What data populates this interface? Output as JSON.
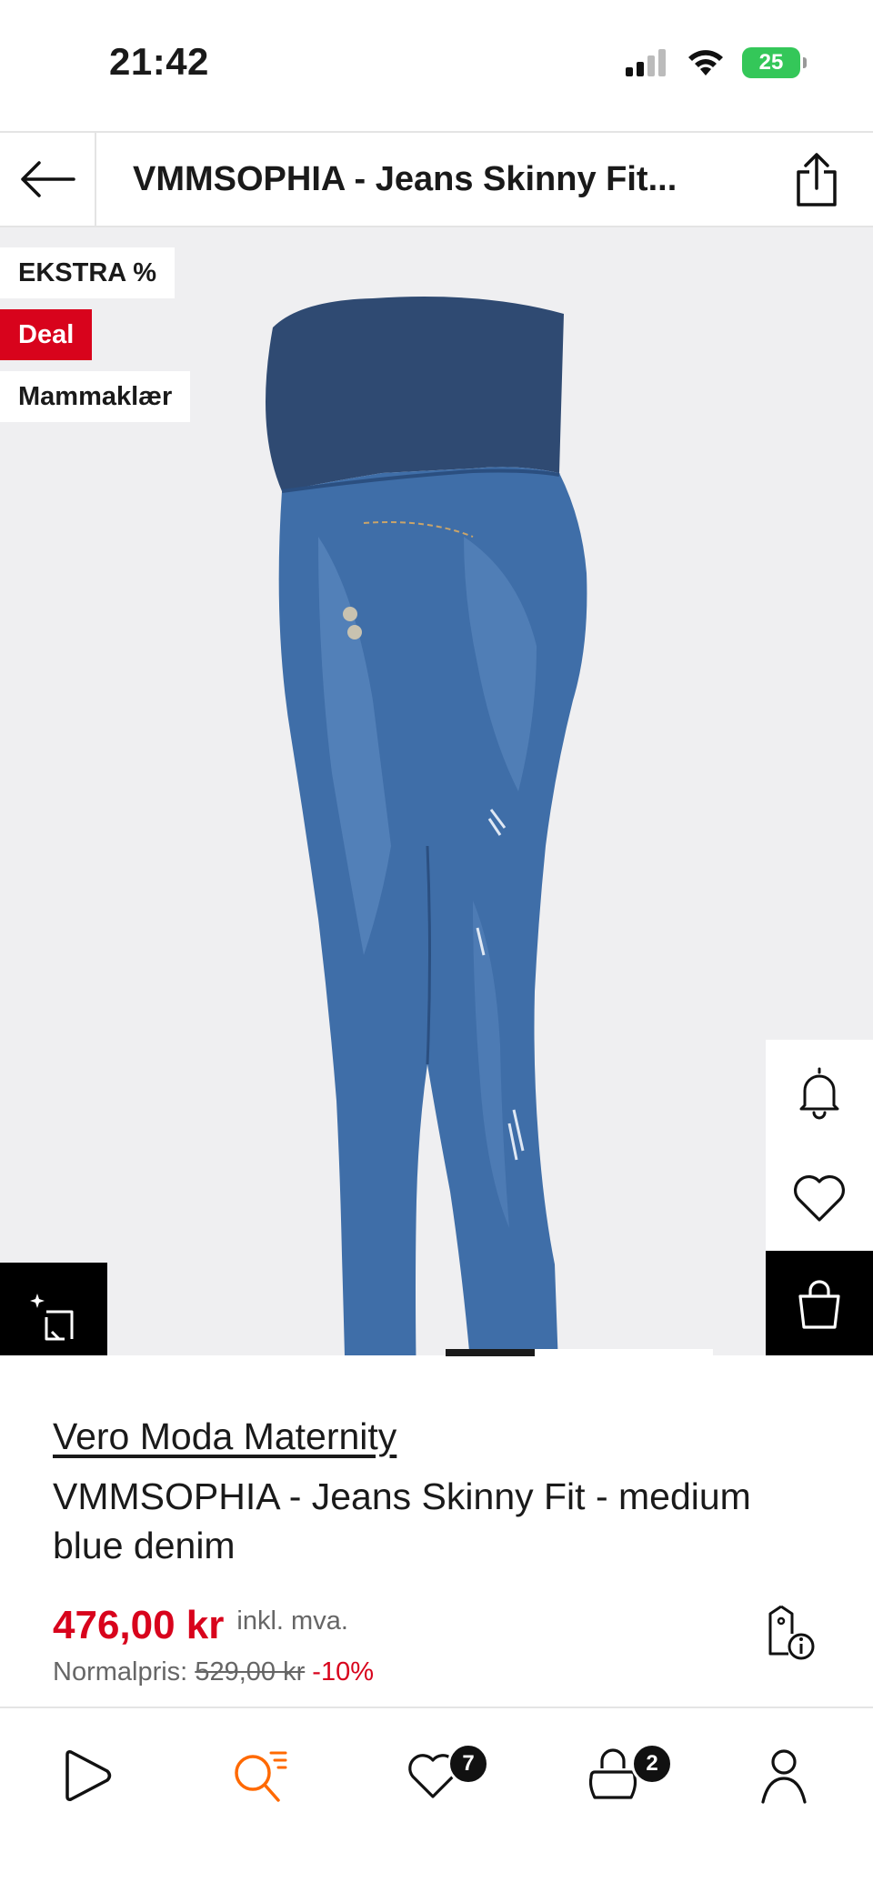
{
  "status_bar": {
    "time": "21:42",
    "battery": "25"
  },
  "header": {
    "title": "VMMSOPHIA - Jeans Skinny Fit..."
  },
  "badges": [
    {
      "label": "EKSTRA %",
      "kind": "neutral"
    },
    {
      "label": "Deal",
      "kind": "red"
    },
    {
      "label": "Mammaklær",
      "kind": "neutral"
    }
  ],
  "gallery": {
    "current_image": 1,
    "total_images": 3
  },
  "product": {
    "brand": "Vero Moda Maternity",
    "name": "VMMSOPHIA - Jeans Skinny Fit - medium blue denim",
    "price": "476,00 kr",
    "vat_note": "inkl. mva.",
    "normal_label": "Normalpris:",
    "normal_price": "529,00 kr",
    "discount": "-10%"
  },
  "bottom_nav": {
    "items": [
      {
        "id": "home",
        "icon": "play-logo-icon"
      },
      {
        "id": "search",
        "icon": "search-list-icon",
        "active": true
      },
      {
        "id": "wishlist",
        "icon": "heart-icon",
        "badge": "7"
      },
      {
        "id": "bag",
        "icon": "bag-icon",
        "badge": "2"
      },
      {
        "id": "account",
        "icon": "person-icon"
      }
    ]
  },
  "colors": {
    "accent_red": "#d8031c",
    "active_orange": "#ff6900",
    "image_bg": "#efeff1",
    "denim": "#3f6ea8",
    "belly_band": "#2f4a72"
  }
}
